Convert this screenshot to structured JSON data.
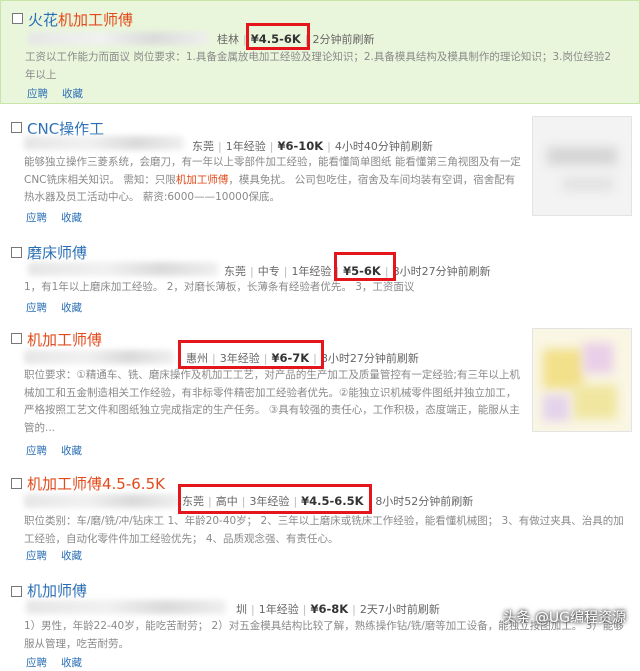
{
  "colors": {
    "title_blue": "#2a6fb6",
    "title_red": "#e34a1a",
    "highlight_bg": "#eaf6dc",
    "red_box": "#e4161b"
  },
  "actions": {
    "apply": "应聘",
    "favorite": "收藏"
  },
  "jobs": [
    {
      "title_a": "火花",
      "title_b": "机加工师傅",
      "location": "桂林",
      "salary": "¥4.5-6K",
      "updated": "2分钟前刷新",
      "desc": "工资以工作能力而面议 岗位要求：1.具备金属放电加工经验及理论知识；2.具备模具结构及模具制作的理论知识；3.岗位经验2年以上"
    },
    {
      "title": "CNC操作工",
      "location": "东莞",
      "experience": "1年经验",
      "salary": "¥6-10K",
      "updated": "4小时40分钟前刷新",
      "desc_a": "能够独立操作三菱系统，会磨刀，有一年以上零部件加工经验，能看懂简单图纸 能看懂第三角视图及有一定CNC铣床相关知识。 需知：只限",
      "desc_kw": "机加工师傅",
      "desc_b": "，模具免扰。 公司包吃住，宿舍及车间均装有空调，宿舍配有热水器及员工活动中心。 薪资:6000——10000保底。"
    },
    {
      "title": "磨床师傅",
      "location": "东莞",
      "education": "中专",
      "experience": "1年经验",
      "salary": "¥5-6K",
      "updated": "8小时27分钟前刷新",
      "desc": "1，有1年以上磨床加工经验。 2，对磨长薄板，长薄条有经验者优先。 3，工资面议"
    },
    {
      "title": "机加工师傅",
      "location": "惠州",
      "experience": "3年经验",
      "salary": "¥6-7K",
      "updated": "8小时27分钟前刷新",
      "desc": "职位要求：①精通车、铣、磨床操作及机加工工艺，对产品的生产加工及质量管控有一定经验;有三年以上机械加工和五金制造相关工作经验，有非标零件精密加工经验者优先。②能独立识机械零件图纸并独立加工，严格按照工艺文件和图纸独立完成指定的生产任务。 ③具有较强的责任心，工作积极，态度端正，能服从主管的..."
    },
    {
      "title": "机加工师傅4.5-6.5K",
      "location": "东莞",
      "education": "高中",
      "experience": "3年经验",
      "salary": "¥4.5-6.5K",
      "updated": "8小时52分钟前刷新",
      "desc": "职位类别：车/磨/铣/冲/钻床工 1、年龄20-40岁； 2、三年以上磨床或铣床工作经验，能看懂机械图； 3、有做过夹具、治具的加工经验，自动化零件件加工经验优先； 4、品质观念强、有责任心。"
    },
    {
      "title": "机加师傅",
      "location_partial": "圳",
      "experience": "1年经验",
      "salary": "¥6-8K",
      "updated": "2天7小时前刷新",
      "desc": "1）男性，年龄22-40岁，能吃苦耐劳； 2）对五金模具结构比较了解，熟练操作钻/铣/磨等加工设备，能独立按图加工。 3）能够服从管理，吃苦耐劳。"
    }
  ],
  "watermark": "头条 @UG编程资源"
}
